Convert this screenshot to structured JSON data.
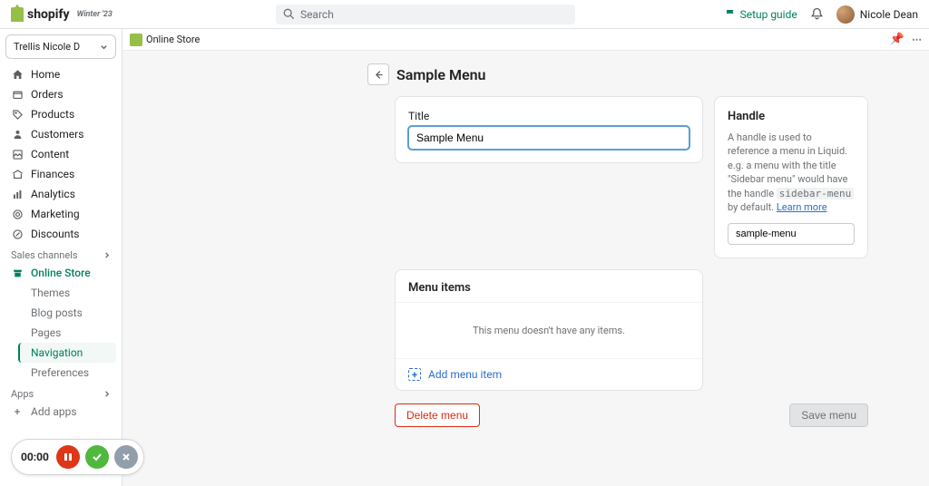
{
  "header": {
    "brand": "shopify",
    "edition": "Winter '23",
    "search_placeholder": "Search",
    "setup_guide": "Setup guide",
    "user_name": "Nicole Dean"
  },
  "store_selector": "Trellis Nicole D",
  "nav": {
    "home": "Home",
    "orders": "Orders",
    "products": "Products",
    "customers": "Customers",
    "content": "Content",
    "finances": "Finances",
    "analytics": "Analytics",
    "marketing": "Marketing",
    "discounts": "Discounts"
  },
  "sales_channels_label": "Sales channels",
  "online_store": {
    "label": "Online Store",
    "themes": "Themes",
    "blog_posts": "Blog posts",
    "pages": "Pages",
    "navigation": "Navigation",
    "preferences": "Preferences"
  },
  "apps_label": "Apps",
  "add_apps": "Add apps",
  "breadcrumb": "Online Store",
  "page": {
    "title": "Sample Menu",
    "title_label": "Title",
    "title_value": "Sample Menu",
    "menu_items_heading": "Menu items",
    "empty_text": "This menu doesn't have any items.",
    "add_item": "Add menu item",
    "handle_heading": "Handle",
    "handle_help_1": "A handle is used to reference a menu in Liquid. e.g. a menu with the title \"Sidebar menu\" would have the handle ",
    "handle_code": "sidebar-menu",
    "handle_help_2": " by default. ",
    "learn_more": "Learn more",
    "handle_value": "sample-menu",
    "delete_btn": "Delete menu",
    "save_btn": "Save menu"
  },
  "recorder": {
    "time": "00:00"
  }
}
